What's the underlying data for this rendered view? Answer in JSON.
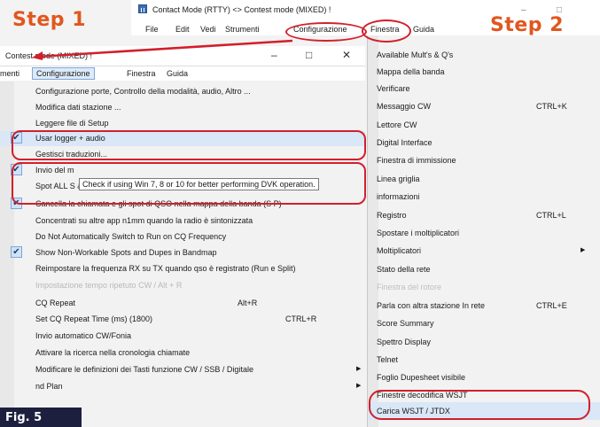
{
  "steps": {
    "step1": "Step 1",
    "step2": "Step 2"
  },
  "main_window": {
    "title": "Contact Mode (RTTY) <> Contest mode (MIXED) !",
    "menu": [
      "File",
      "Edit",
      "Vedi",
      "Strumenti",
      "Configurazione",
      "Finestra",
      "Guida"
    ],
    "controls": [
      "–",
      "□"
    ]
  },
  "left_window": {
    "title": "Contest mode (MIXED) !",
    "controls": [
      "–",
      "□",
      "✕"
    ],
    "menu": [
      "menti",
      "Configurazione",
      "Finestra",
      "Guida"
    ],
    "items": [
      {
        "label": "Configurazione porte, Controllo della modalità, audio, Altro ..."
      },
      {
        "label": "Modifica dati stazione ..."
      },
      {
        "label": "Leggere file di Setup"
      },
      {
        "label": "Usar logger + audio",
        "checked": true
      },
      {
        "label": "Gestisci traduzioni..."
      },
      {
        "label": "Invio del m",
        "checked": true
      },
      {
        "label": "Spot ALL S & P QSOs"
      },
      {
        "label": "Cancella la chiamata e gli spot di QSO nella mappa della banda (S  P)",
        "checked": true
      },
      {
        "label": "Concentrati su altre app n1mm quando la radio è sintonizzata"
      },
      {
        "label": "Do Not Automatically Switch to Run on CQ Frequency"
      },
      {
        "label": "Show Non-Workable Spots and Dupes in Bandmap",
        "checked": true
      },
      {
        "label": "Reimpostare la frequenza RX su TX quando qso è registrato (Run e Split)"
      },
      {
        "label": "Impostazione tempo ripetuto CW / Alt + R",
        "dim": true
      },
      {
        "label": "CQ Repeat",
        "shortcut": "Alt+R"
      },
      {
        "label": "Set CQ Repeat Time (ms) (1800)",
        "shortcut": "CTRL+R"
      },
      {
        "label": "Invio automatico CW/Fonia"
      },
      {
        "label": "Attivare la ricerca nella cronologia chiamate"
      },
      {
        "label": "Modificare le definizioni dei Tasti funzione CW / SSB / Digitale",
        "submenu": true
      },
      {
        "label": "nd Plan",
        "submenu": true
      }
    ],
    "tooltip": "Check if using Win 7, 8 or 10 for better performing DVK operation."
  },
  "right_menu": {
    "items": [
      {
        "label": "Available Mult's & Q's"
      },
      {
        "label": "Mappa della banda"
      },
      {
        "label": "Verificare"
      },
      {
        "label": "Messaggio CW",
        "shortcut": "CTRL+K"
      },
      {
        "label": "Lettore CW"
      },
      {
        "label": "Digital Interface"
      },
      {
        "label": "Finestra di immissione"
      },
      {
        "label": "Linea griglia"
      },
      {
        "label": "informazioni"
      },
      {
        "label": "Registro",
        "shortcut": "CTRL+L"
      },
      {
        "label": "Spostare i moltiplicatori"
      },
      {
        "label": "Moltiplicatori",
        "submenu": true
      },
      {
        "label": "Stato della rete"
      },
      {
        "label": "Finestra del rotore",
        "dim": true
      },
      {
        "label": "Parla con altra stazione In rete",
        "shortcut": "CTRL+E"
      },
      {
        "label": "Score Summary"
      },
      {
        "label": "Spettro Display"
      },
      {
        "label": "Telnet"
      },
      {
        "label": "Foglio Dupesheet visibile"
      },
      {
        "label": "Finestre decodifica WSJT"
      },
      {
        "label": "Carica WSJT / JTDX"
      }
    ]
  },
  "figure": {
    "label": "Fig. 5"
  },
  "colors": {
    "annotation_red": "#d21f2b",
    "step_orange": "#e0571f",
    "fig_navy": "#1d1f3f",
    "highlight": "#d9e7f7"
  }
}
